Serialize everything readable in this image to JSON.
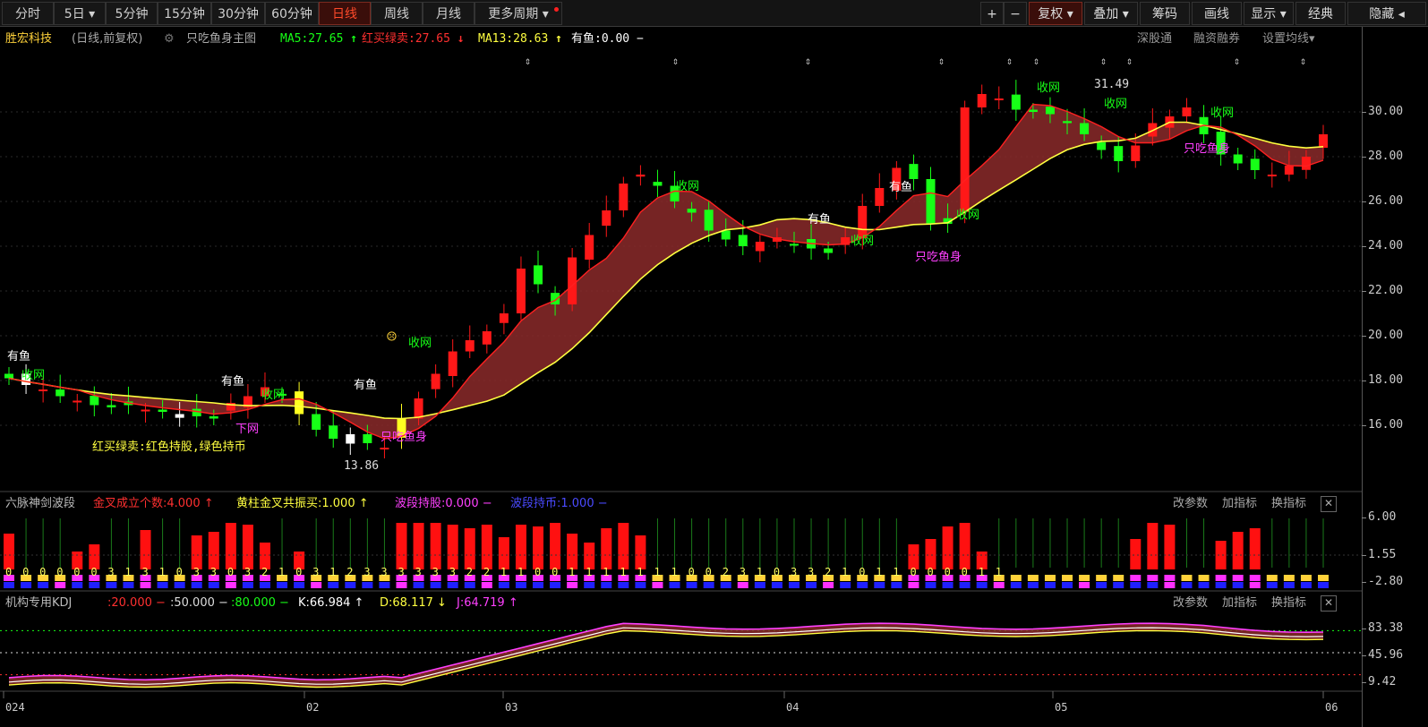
{
  "toolbar": {
    "left_buttons": [
      "分时",
      "5日",
      "5分钟",
      "15分钟",
      "30分钟",
      "60分钟",
      "日线",
      "周线",
      "月线",
      "更多周期"
    ],
    "active": "日线",
    "right_buttons": [
      "+",
      "−",
      "复权",
      "叠加",
      "筹码",
      "画线",
      "显示",
      "经典",
      "隐藏"
    ]
  },
  "main_info": {
    "stock": "胜宏科技",
    "period": "(日线,前复权)",
    "indicator": "只吃鱼身主图",
    "ma5": "MA5:27.65",
    "hmlm": "红买绿卖:27.65",
    "ma13": "MA13:28.63",
    "youyu": "有鱼:0.00",
    "dash": "−",
    "links": [
      "深股通",
      "融资融券",
      "设置均线"
    ]
  },
  "price_axis": [
    "30.00",
    "28.00",
    "26.00",
    "24.00",
    "22.00",
    "20.00",
    "18.00",
    "16.00"
  ],
  "chart_labels": {
    "high": "31.49",
    "low": "13.86",
    "youyu": "有鱼",
    "shouwang": "收网",
    "xiawang": "下网",
    "zhichi": "只吃鱼身",
    "legend": "红买绿卖:红色持股,绿色持币"
  },
  "sub1": {
    "title": "六脉神剑波段",
    "a": "金叉成立个数:4.000",
    "b": "黄柱金叉共振买:1.000",
    "c": "波段持股:0.000",
    "d": "波段持币:1.000",
    "dash": "−",
    "links": [
      "改参数",
      "加指标",
      "换指标"
    ],
    "axis": [
      "6.00",
      "1.55",
      "-2.80"
    ],
    "digits": "00000031310330321031233333322110011111110023103321011000011"
  },
  "sub2": {
    "title": "机构专用KDJ",
    "l20": ":20.000",
    "l50": ":50.000",
    "l80": ":80.000",
    "k": "K:66.984",
    "d": "D:68.117",
    "j": "J:64.719",
    "dash": "−",
    "links": [
      "改参数",
      "加指标",
      "换指标"
    ],
    "axis": [
      "83.38",
      "45.96",
      "9.42"
    ]
  },
  "time_axis": [
    "024",
    "02",
    "03",
    "04",
    "05",
    "06"
  ],
  "colors": {
    "up": "#ff1818",
    "down": "#17ff17",
    "ma": "#ffff40",
    "band": "#8b2a2a",
    "magenta": "#ff40ff"
  }
}
